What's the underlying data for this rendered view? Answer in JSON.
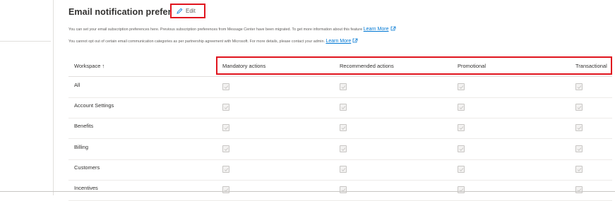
{
  "header": {
    "title": "Email notification preferences",
    "edit_label": "Edit"
  },
  "info": {
    "line1_text": "You can set your email subscription preferences here. Previous subscription preferences from Message Center have been migrated. To get more information about this feature ",
    "line2_text": "You cannot opt out of certain email communication categories as per partnership agreement with Microsoft. For more details, please contact your admin. ",
    "link_label": "Learn More"
  },
  "table": {
    "columns": [
      "Workspace",
      "Mandatory actions",
      "Recommended actions",
      "Promotional",
      "Transactional"
    ],
    "sort_indicator": "↑",
    "rows": [
      {
        "workspace": "All",
        "checked": [
          true,
          true,
          true,
          true
        ]
      },
      {
        "workspace": "Account Settings",
        "checked": [
          true,
          true,
          true,
          true
        ]
      },
      {
        "workspace": "Benefits",
        "checked": [
          true,
          true,
          true,
          true
        ]
      },
      {
        "workspace": "Billing",
        "checked": [
          true,
          true,
          true,
          true
        ]
      },
      {
        "workspace": "Customers",
        "checked": [
          true,
          true,
          true,
          true
        ]
      },
      {
        "workspace": "Incentives",
        "checked": [
          true,
          true,
          true,
          true
        ]
      }
    ]
  },
  "colors": {
    "highlight": "#e0141e",
    "link": "#0078d4",
    "text": "#323130"
  }
}
